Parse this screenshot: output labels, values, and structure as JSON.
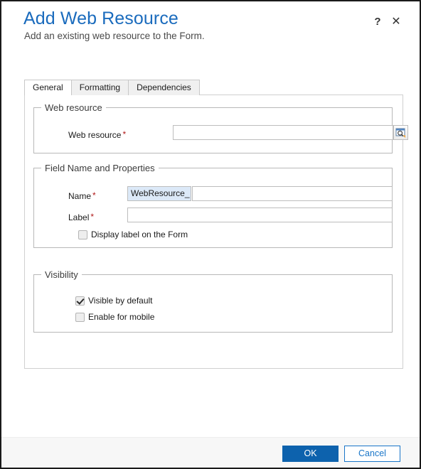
{
  "header": {
    "title": "Add Web Resource",
    "subtitle": "Add an existing web resource to the Form.",
    "help_icon": "?",
    "close_icon": "✕"
  },
  "tabs": [
    {
      "label": "General"
    },
    {
      "label": "Formatting"
    },
    {
      "label": "Dependencies"
    }
  ],
  "sections": {
    "web_resource": {
      "legend": "Web resource",
      "field_label": "Web resource",
      "required_marker": "*",
      "input_value": "",
      "lookup_button_title": "Browse"
    },
    "field_name": {
      "legend": "Field Name and Properties",
      "name_label": "Name",
      "name_required_marker": "*",
      "name_prefix": "WebResource_",
      "name_value": "",
      "label_label": "Label",
      "label_required_marker": "*",
      "label_value": "",
      "display_label_checkbox": "Display label on the Form"
    },
    "visibility": {
      "legend": "Visibility",
      "visible_by_default_checkbox": "Visible by default",
      "enable_for_mobile_checkbox": "Enable for mobile"
    }
  },
  "footer": {
    "ok_label": "OK",
    "cancel_label": "Cancel"
  },
  "colors": {
    "title_blue": "#1a6bbd",
    "primary_button": "#0d62ad",
    "link_blue": "#1a76c8",
    "required_red": "#b01818",
    "prefix_field_blue": "#dce9f8"
  }
}
